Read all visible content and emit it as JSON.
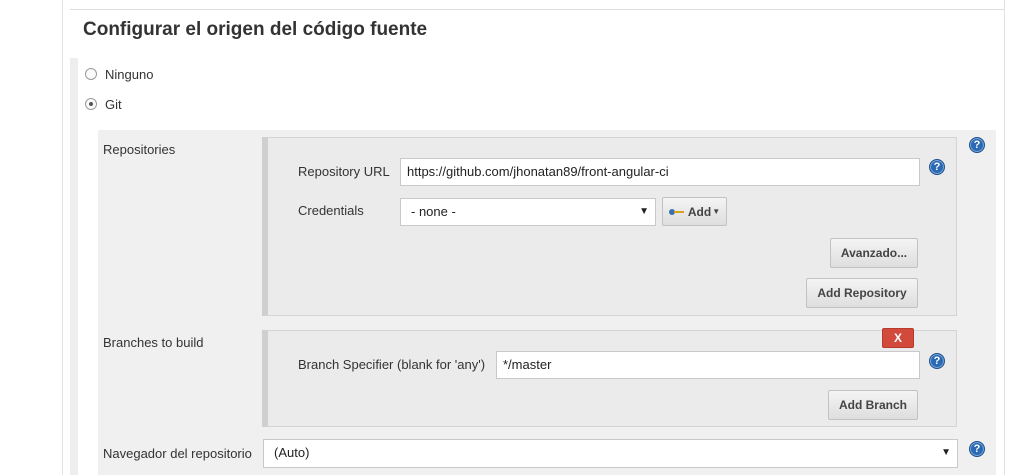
{
  "section": {
    "title": "Configurar el origen del código fuente"
  },
  "scm_options": [
    {
      "label": "Ninguno",
      "checked": false
    },
    {
      "label": "Git",
      "checked": true
    }
  ],
  "repositories": {
    "label": "Repositories",
    "url_label": "Repository URL",
    "url_value": "https://github.com/jhonatan89/front-angular-ci",
    "credentials_label": "Credentials",
    "credentials_value": "- none -",
    "add_label": "Add",
    "advanced_label": "Avanzado...",
    "add_repository_label": "Add Repository"
  },
  "branches": {
    "label": "Branches to build",
    "specifier_label": "Branch Specifier (blank for 'any')",
    "specifier_value": "*/master",
    "delete_label": "X",
    "add_branch_label": "Add Branch"
  },
  "browser": {
    "label": "Navegador del repositorio",
    "value": "(Auto)"
  },
  "help_icon_glyph": "?",
  "colors": {
    "help": "#2a6ab4",
    "delete": "#d24a3c"
  }
}
